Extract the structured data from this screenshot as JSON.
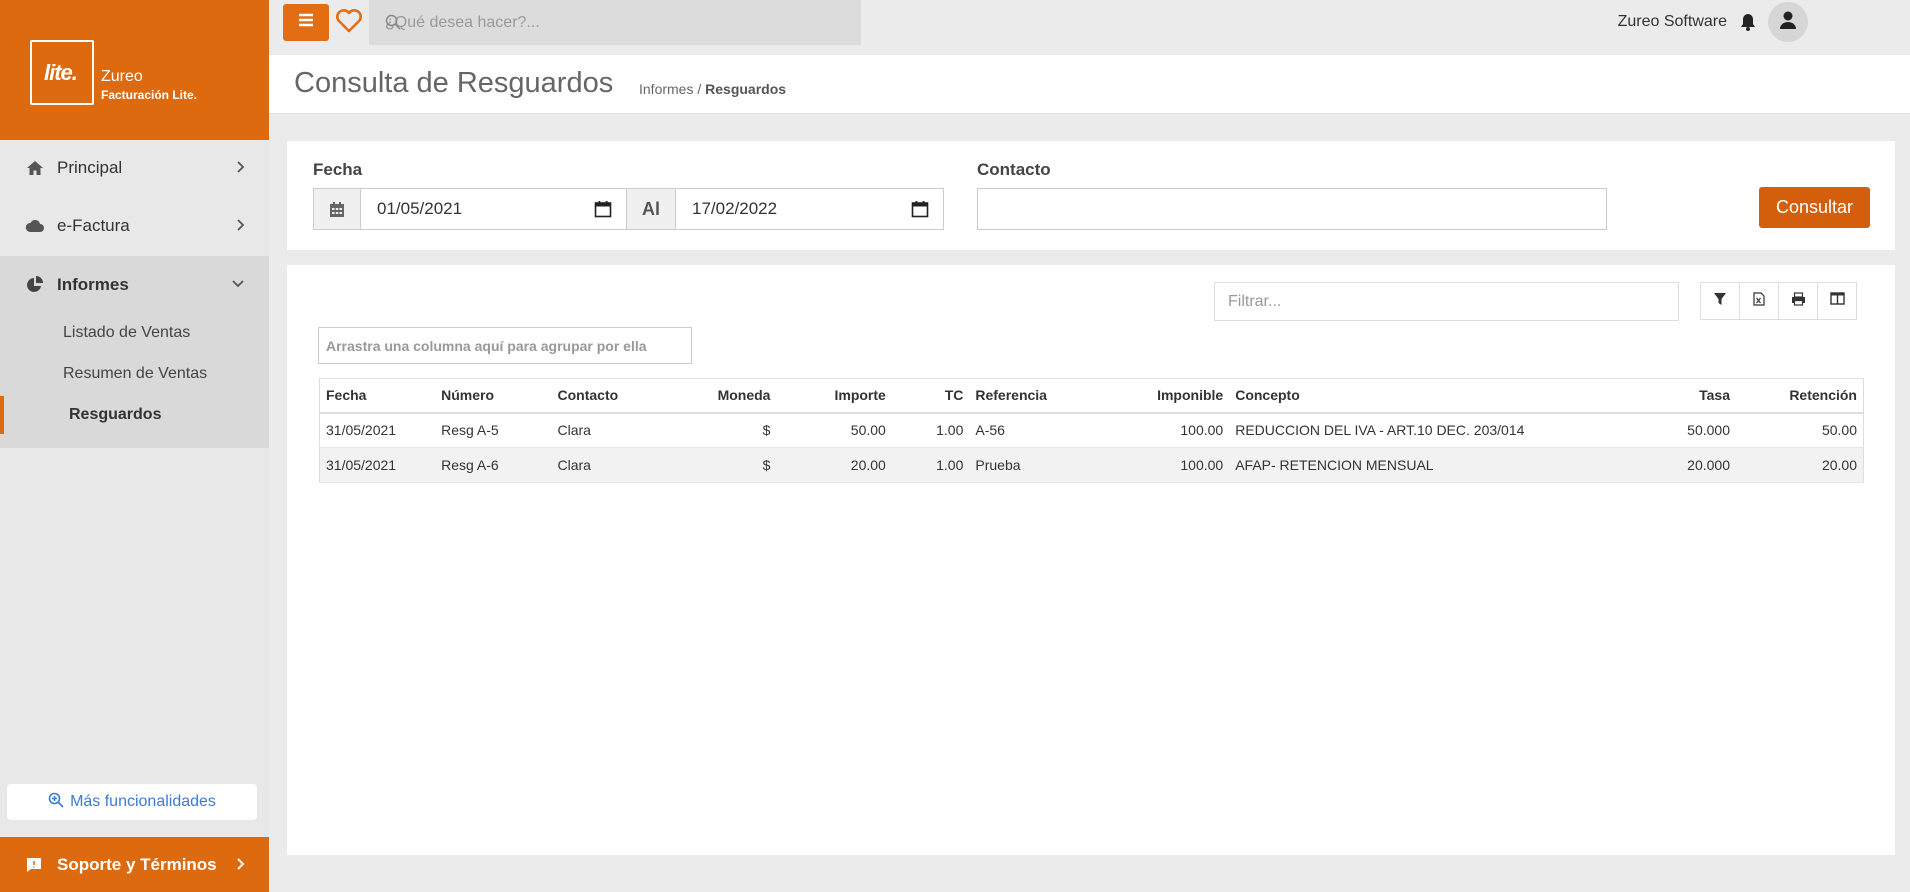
{
  "brand": {
    "logo_text": "lite.",
    "name": "Zureo",
    "subtitle": "Facturación Lite."
  },
  "sidebar": {
    "items": [
      {
        "label": "Principal"
      },
      {
        "label": "e-Factura"
      },
      {
        "label": "Informes"
      }
    ],
    "subitems": [
      {
        "label": "Listado de Ventas"
      },
      {
        "label": "Resumen de Ventas"
      },
      {
        "label": "Resguardos"
      }
    ],
    "more_label": "Más funcionalidades",
    "support_label": "Soporte y Términos"
  },
  "topbar": {
    "search_placeholder": "¿Qué desea hacer?...",
    "company": "Zureo Software"
  },
  "header": {
    "title": "Consulta de Resguardos",
    "breadcrumb_parent": "Informes",
    "breadcrumb_sep": " / ",
    "breadcrumb_current": "Resguardos"
  },
  "filters": {
    "fecha_label": "Fecha",
    "date_from": "01/05/2021",
    "al_label": "Al",
    "date_to": "17/02/2022",
    "contacto_label": "Contacto",
    "contacto_value": "",
    "consultar_label": "Consultar"
  },
  "grid": {
    "filter_placeholder": "Filtrar...",
    "group_hint": "Arrastra una columna aquí para agrupar por ella",
    "columns": [
      "Fecha",
      "Número",
      "Contacto",
      "Moneda",
      "Importe",
      "TC",
      "Referencia",
      "Imponible",
      "Concepto",
      "Tasa",
      "Retención"
    ],
    "rows": [
      [
        "31/05/2021",
        "Resg A-5",
        "Clara",
        "$",
        "50.00",
        "1.00",
        "A-56",
        "100.00",
        "REDUCCION DEL IVA - ART.10 DEC. 203/014",
        "50.000",
        "50.00"
      ],
      [
        "31/05/2021",
        "Resg A-6",
        "Clara",
        "$",
        "20.00",
        "1.00",
        "Prueba",
        "100.00",
        "AFAP- RETENCION MENSUAL",
        "20.000",
        "20.00"
      ]
    ]
  },
  "colors": {
    "accent": "#dd6a0e",
    "button": "#d35e0b",
    "link": "#3a7bd5"
  }
}
